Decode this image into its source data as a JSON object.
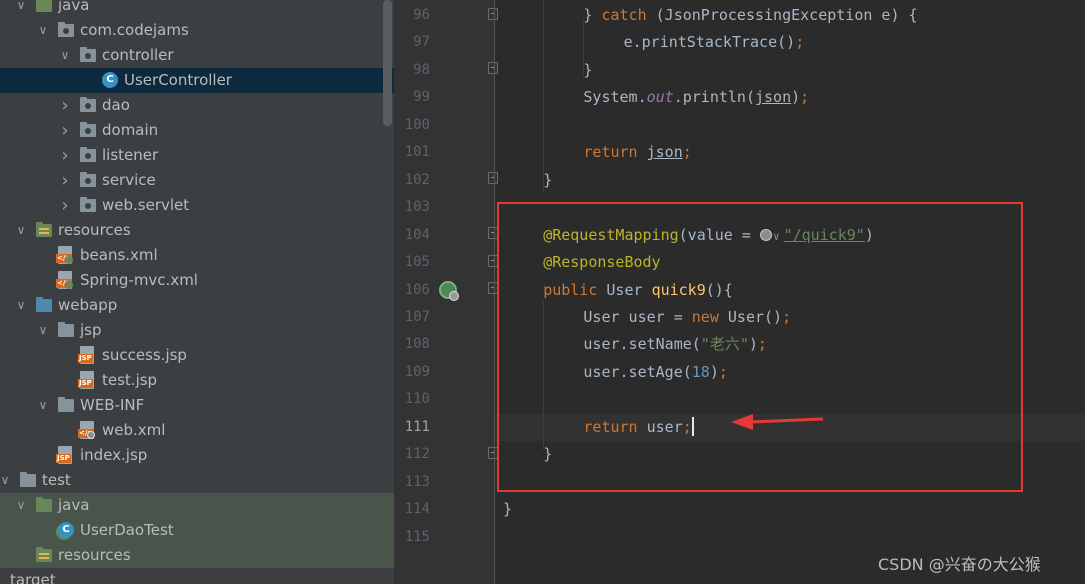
{
  "project_tree": {
    "items": [
      {
        "label": "java",
        "depth": 1,
        "arrow": "down",
        "icon": "source-folder-icon"
      },
      {
        "label": "com.codejams",
        "depth": 2,
        "arrow": "down",
        "icon": "package-icon"
      },
      {
        "label": "controller",
        "depth": 3,
        "arrow": "down",
        "icon": "package-icon"
      },
      {
        "label": "UserController",
        "depth": 4,
        "arrow": "",
        "icon": "java-class-icon",
        "selected": true
      },
      {
        "label": "dao",
        "depth": 3,
        "arrow": "right",
        "icon": "package-icon"
      },
      {
        "label": "domain",
        "depth": 3,
        "arrow": "right",
        "icon": "package-icon"
      },
      {
        "label": "listener",
        "depth": 3,
        "arrow": "right",
        "icon": "package-icon"
      },
      {
        "label": "service",
        "depth": 3,
        "arrow": "right",
        "icon": "package-icon"
      },
      {
        "label": "web.servlet",
        "depth": 3,
        "arrow": "right",
        "icon": "package-icon"
      },
      {
        "label": "resources",
        "depth": 1,
        "arrow": "down",
        "icon": "resources-folder-icon"
      },
      {
        "label": "beans.xml",
        "depth": 2,
        "arrow": "",
        "icon": "spring-xml-icon"
      },
      {
        "label": "Spring-mvc.xml",
        "depth": 2,
        "arrow": "",
        "icon": "spring-xml-icon"
      },
      {
        "label": "webapp",
        "depth": 1,
        "arrow": "down",
        "icon": "web-folder-icon"
      },
      {
        "label": "jsp",
        "depth": 2,
        "arrow": "down",
        "icon": "folder-icon"
      },
      {
        "label": "success.jsp",
        "depth": 3,
        "arrow": "",
        "icon": "jsp-file-icon"
      },
      {
        "label": "test.jsp",
        "depth": 3,
        "arrow": "",
        "icon": "jsp-file-icon"
      },
      {
        "label": "WEB-INF",
        "depth": 2,
        "arrow": "down",
        "icon": "folder-icon"
      },
      {
        "label": "web.xml",
        "depth": 3,
        "arrow": "",
        "icon": "web-xml-icon"
      },
      {
        "label": "index.jsp",
        "depth": 2,
        "arrow": "",
        "icon": "jsp-file-icon"
      },
      {
        "label": "test",
        "depth": 0,
        "arrow": "down",
        "icon": "folder-icon"
      },
      {
        "label": "java",
        "depth": 1,
        "arrow": "down",
        "icon": "test-source-folder-icon",
        "test": true
      },
      {
        "label": "UserDaoTest",
        "depth": 2,
        "arrow": "",
        "icon": "test-class-icon",
        "test": true
      },
      {
        "label": "resources",
        "depth": 1,
        "arrow": "",
        "icon": "resources-folder-icon",
        "test": true
      },
      {
        "label": "target",
        "depth": 0,
        "arrow": "",
        "icon": "",
        "test": false
      }
    ]
  },
  "editor": {
    "current_line": "111",
    "lines": [
      {
        "no": "96",
        "tokens": [
          {
            "t": "} ",
            "c": ""
          },
          {
            "t": "catch",
            "c": "kw"
          },
          {
            "t": " (JsonProcessingException e) {",
            "c": ""
          }
        ]
      },
      {
        "no": "97",
        "tokens": [
          {
            "t": "e.printStackTrace()",
            "c": ""
          },
          {
            "t": ";",
            "c": "kw"
          }
        ]
      },
      {
        "no": "98",
        "tokens": [
          {
            "t": "}",
            "c": ""
          }
        ]
      },
      {
        "no": "99",
        "tokens": [
          {
            "t": "System.",
            "c": ""
          },
          {
            "t": "out",
            "c": "fld"
          },
          {
            "t": ".println(",
            "c": ""
          },
          {
            "t": "json",
            "c": "ul"
          },
          {
            "t": ")",
            "c": ""
          },
          {
            "t": ";",
            "c": "kw"
          }
        ]
      },
      {
        "no": "100",
        "tokens": []
      },
      {
        "no": "101",
        "tokens": [
          {
            "t": "return ",
            "c": "kw"
          },
          {
            "t": "json",
            "c": "ul"
          },
          {
            "t": ";",
            "c": "kw"
          }
        ]
      },
      {
        "no": "102",
        "tokens": [
          {
            "t": "}",
            "c": ""
          }
        ]
      },
      {
        "no": "103",
        "tokens": []
      },
      {
        "no": "104",
        "tokens": [
          {
            "t": "@RequestMapping",
            "c": "ann"
          },
          {
            "t": "(value = ",
            "c": ""
          },
          {
            "t": "",
            "c": "globe"
          },
          {
            "t": "∨",
            "c": "chev"
          },
          {
            "t": "\"/quick9\"",
            "c": "link"
          },
          {
            "t": ")",
            "c": ""
          }
        ]
      },
      {
        "no": "105",
        "tokens": [
          {
            "t": "@ResponseBody",
            "c": "ann"
          }
        ]
      },
      {
        "no": "106",
        "tokens": [
          {
            "t": "public ",
            "c": "kw"
          },
          {
            "t": "User ",
            "c": ""
          },
          {
            "t": "quick9",
            "c": "fn"
          },
          {
            "t": "(){",
            "c": ""
          }
        ]
      },
      {
        "no": "107",
        "tokens": [
          {
            "t": "User user = ",
            "c": ""
          },
          {
            "t": "new ",
            "c": "kw"
          },
          {
            "t": "User()",
            "c": ""
          },
          {
            "t": ";",
            "c": "kw"
          }
        ]
      },
      {
        "no": "108",
        "tokens": [
          {
            "t": "user.setName(",
            "c": ""
          },
          {
            "t": "\"老六\"",
            "c": "str"
          },
          {
            "t": ")",
            "c": ""
          },
          {
            "t": ";",
            "c": "kw"
          }
        ]
      },
      {
        "no": "109",
        "tokens": [
          {
            "t": "user.setAge(",
            "c": ""
          },
          {
            "t": "18",
            "c": "num"
          },
          {
            "t": ")",
            "c": ""
          },
          {
            "t": ";",
            "c": "kw"
          }
        ]
      },
      {
        "no": "110",
        "tokens": []
      },
      {
        "no": "111",
        "tokens": [
          {
            "t": "return ",
            "c": "kw"
          },
          {
            "t": "user",
            "c": ""
          },
          {
            "t": ";",
            "c": "kw"
          },
          {
            "t": "",
            "c": "caret"
          }
        ]
      },
      {
        "no": "112",
        "tokens": [
          {
            "t": "}",
            "c": ""
          }
        ]
      },
      {
        "no": "113",
        "tokens": []
      },
      {
        "no": "114",
        "tokens": [
          {
            "t": "}",
            "c": ""
          }
        ]
      },
      {
        "no": "115",
        "tokens": []
      }
    ]
  },
  "watermark": "CSDN @兴奋の大公猴",
  "colors": {
    "tree_bg": "#3c3f41",
    "selected_row": "#0d293e",
    "editor_bg": "#2b2b2b",
    "keyword": "#cc7832",
    "annotation": "#bbb529",
    "string": "#6a8759",
    "method": "#ffc66d",
    "highlight_box": "#e53935"
  }
}
